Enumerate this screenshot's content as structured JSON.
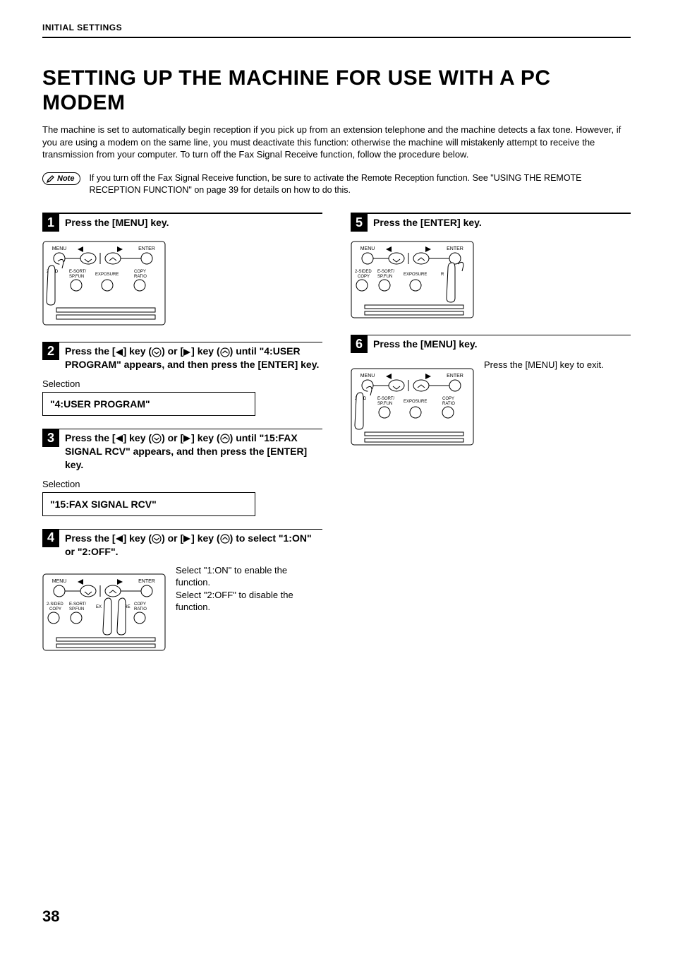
{
  "header": "INITIAL SETTINGS",
  "title": "SETTING UP THE MACHINE FOR USE WITH A PC MODEM",
  "intro": "The machine is set to automatically begin reception if you pick up from an extension telephone and the machine detects a fax tone. However, if you are using a modem on the same line, you must deactivate this function: otherwise the machine will mistakenly attempt to receive the transmission from your computer. To turn off the Fax Signal Receive function, follow the procedure below.",
  "note_label": "Note",
  "note_text": "If you turn off the Fax Signal Receive function, be sure to activate the Remote Reception function. See \"USING THE REMOTE RECEPTION FUNCTION\" on page 39 for details on how to do this.",
  "steps": {
    "s1": {
      "num": "1",
      "title": "Press the [MENU] key."
    },
    "s2": {
      "num": "2",
      "title_pre": "Press the [",
      "title_mid1": "] key (",
      "title_mid2": ") or [",
      "title_mid3": "] key (",
      "title_post": ") until \"4:USER PROGRAM\" appears, and then press the [ENTER] key.",
      "selection_label": "Selection",
      "display": "\"4:USER PROGRAM\""
    },
    "s3": {
      "num": "3",
      "title_pre": "Press the [",
      "title_mid1": "] key (",
      "title_mid2": ") or [",
      "title_mid3": "] key (",
      "title_post": ") until \"15:FAX SIGNAL RCV\" appears, and then press the [ENTER] key.",
      "selection_label": "Selection",
      "display": "\"15:FAX SIGNAL RCV\""
    },
    "s4": {
      "num": "4",
      "title_pre": "Press the [",
      "title_mid1": "] key (",
      "title_mid2": ") or [",
      "title_mid3": "] key (",
      "title_post": ") to select \"1:ON\" or \"2:OFF\".",
      "side": "Select \"1:ON\" to enable the function.\nSelect \"2:OFF\" to disable the function."
    },
    "s5": {
      "num": "5",
      "title": "Press the [ENTER] key."
    },
    "s6": {
      "num": "6",
      "title": "Press the [MENU] key.",
      "side": "Press the [MENU] key to exit."
    }
  },
  "panel_labels": {
    "menu": "MENU",
    "enter": "ENTER",
    "twoSided": "2-SIDED",
    "copy": "COPY",
    "esort": "E-SORT/",
    "spfun": "SP.FUN",
    "exposure": "EXPOSURE",
    "copyratio1": "COPY",
    "copyratio2": "RATIO"
  },
  "page_number": "38"
}
